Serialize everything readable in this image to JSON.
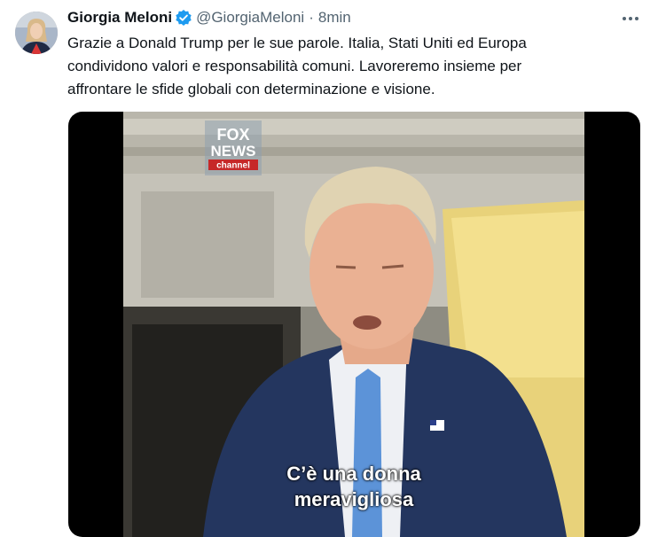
{
  "tweet": {
    "author_name": "Giorgia Meloni",
    "handle": "@GiorgiaMeloni",
    "separator": "·",
    "timestamp": "8min",
    "verified": true,
    "text_lines": [
      "Grazie a Donald Trump per le sue parole. Italia, Stati Uniti ed Europa",
      "condividono valori e responsabilità comuni. Lavoreremo insieme per",
      "affrontare le sfide globali con determinazione e visione."
    ],
    "media": {
      "logo": {
        "line1": "FOX",
        "line2": "NEWS",
        "line3": "channel"
      },
      "caption_line1": "C’è una donna",
      "caption_line2": "meravigliosa"
    }
  },
  "icons": {
    "verified": "verified-badge-icon",
    "more": "more-options-icon"
  },
  "colors": {
    "text": "#0f1419",
    "secondary": "#536471",
    "verified": "#1d9bf0",
    "media_bg": "#000000"
  }
}
